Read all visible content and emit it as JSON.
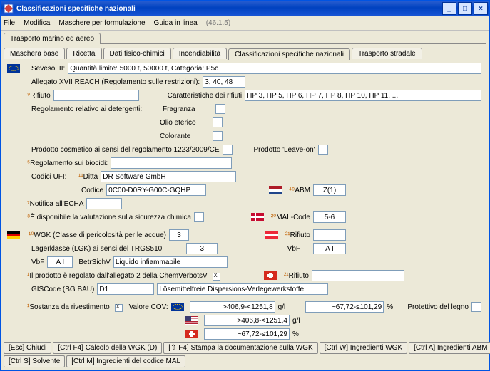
{
  "window": {
    "title": "Classificazioni specifiche nazionali"
  },
  "menu": {
    "file": "File",
    "modifica": "Modifica",
    "maschere": "Maschere per formulazione",
    "guida": "Guida in linea",
    "ver": "(46.1.5)"
  },
  "tabs1": {
    "t1": "Trasporto marino ed aereo"
  },
  "tabs2": {
    "t1": "Maschera base",
    "t2": "Ricetta",
    "t3": "Dati fisico-chimici",
    "t4": "Incendiabilità",
    "t5": "Classificazioni specifiche nazionali",
    "t6": "Trasporto stradale"
  },
  "f": {
    "seveso_l": "Seveso III:",
    "seveso_v": "Quantità limite: 5000 t, 50000 t, Categoria: P5c",
    "allegato_l": "Allegato XVII REACH (Regolamento sulle restrizioni):",
    "allegato_v": "3, 40, 48",
    "rifiuto_l": "Rifiuto",
    "rifiuto_v": "",
    "caratt_l": "Caratteristiche dei rifiuti",
    "caratt_v": "HP 3, HP 5, HP 6, HP 7, HP 8, HP 10, HP 11, ...",
    "deterg_l": "Regolamento relativo ai detergenti:",
    "fragranza": "Fragranza",
    "olio": "Olio eterico",
    "colorante": "Colorante",
    "cosm_l": "Prodotto cosmetico ai sensi del regolamento 1223/2009/CE",
    "leaveon_l": "Prodotto 'Leave-on'",
    "biocidi_l": "Regolamento sui biocidi:",
    "biocidi_v": "",
    "codiciufi_l": "Codici UFI:",
    "ditta_l": "Ditta",
    "ditta_v": "DR Software GmbH",
    "codice_l": "Codice",
    "codice_v": "0C00-D0RY-G00C-GQHP",
    "notifica_l": "Notifica all'ECHA",
    "notifica_v": "",
    "valut_l": "È disponibile la valutazione sulla sicurezza chimica",
    "abm_l": "ABM",
    "abm_v": "Z(1)",
    "mal_l": "MAL-Code",
    "mal_v": "5-6",
    "wgk_l": "WGK (Classe di pericolosità per le acque)",
    "wgk_v": "3",
    "lgk_l": "Lagerklasse (LGK) ai sensi del TRGS510",
    "lgk_v": "3",
    "vbf_l": "VbF",
    "vbf_v": "A I",
    "betr_l": "BetrSichV",
    "betr_v": "Liquido infiammabile",
    "chemv_l": "Il prodotto è regolato dall'allegato 2 della ChemVerbotsV",
    "gis_l": "GISCode (BG BAU)",
    "gis_v": "D1",
    "gis_desc": "Lösemittelfreie Dispersions-Verlegewerkstoffe",
    "at_rifiuto_l": "Rifiuto",
    "at_rifiuto_v": "",
    "at_vbf_l": "VbF",
    "at_vbf_v": "A I",
    "ch_rifiuto_l": "Rifiuto",
    "ch_rifiuto_v": "",
    "sost_l": "Sostanza da rivestimento",
    "voc_l": "Valore COV:",
    "voc_eu": ">406,9-<1251,8",
    "voc_eu_u": "g/l",
    "voc_us": ">406,8-<1251,4",
    "voc_us_u": "g/l",
    "voc_ch": "~67,72-≤101,29",
    "voc_ch_u": "%",
    "voc_pct": "~67,72-≤101,29",
    "voc_pct_u": "%",
    "prot_l": "Protettivo del legno"
  },
  "btns": {
    "b1": "[Esc] Chiudi",
    "b2": "[Ctrl F4] Calcolo della WGK (D)",
    "b3": "[⇧ F4] Stampa la documentazione sulla WGK",
    "b4": "[Ctrl W] Ingredienti WGK",
    "b5": "[Ctrl A] Ingredienti ABM",
    "b6": "[Ctrl S] Solvente",
    "b7": "[Ctrl M] Ingredienti del codice MAL"
  }
}
